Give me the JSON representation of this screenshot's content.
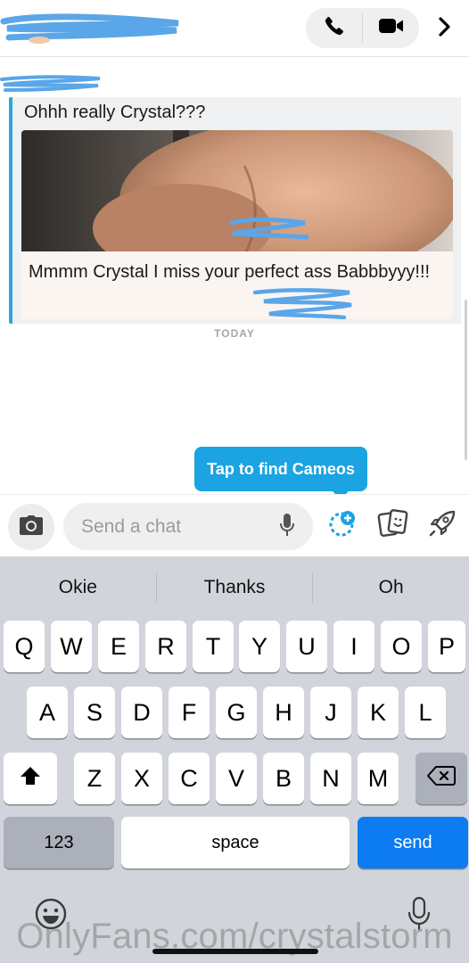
{
  "header": {
    "call_icon": "phone-icon",
    "video_icon": "video-camera-icon",
    "more_icon": "chevron-right-icon"
  },
  "chat": {
    "quoted_text": "Ohhh really Crystal???",
    "caption": "Mmmm Crystal I miss your perfect ass Babbbyyy!!!",
    "date_divider": "TODAY"
  },
  "tooltip": {
    "text": "Tap to find Cameos"
  },
  "composer": {
    "placeholder": "Send a chat",
    "camera_icon": "camera-icon",
    "mic_icon": "microphone-icon",
    "cameo_icon": "cameo-face-icon",
    "stickers_icon": "stickers-card-icon",
    "games_icon": "rocket-icon"
  },
  "keyboard": {
    "suggestions": [
      "Okie",
      "Thanks",
      "Oh"
    ],
    "row1": [
      "Q",
      "W",
      "E",
      "R",
      "T",
      "Y",
      "U",
      "I",
      "O",
      "P"
    ],
    "row2": [
      "A",
      "S",
      "D",
      "F",
      "G",
      "H",
      "J",
      "K",
      "L"
    ],
    "row3": [
      "Z",
      "X",
      "C",
      "V",
      "B",
      "N",
      "M"
    ],
    "numbers_label": "123",
    "space_label": "space",
    "send_label": "send",
    "send_color": "#0d7bf2"
  },
  "watermark": "OnlyFans.com/crystalstorm"
}
